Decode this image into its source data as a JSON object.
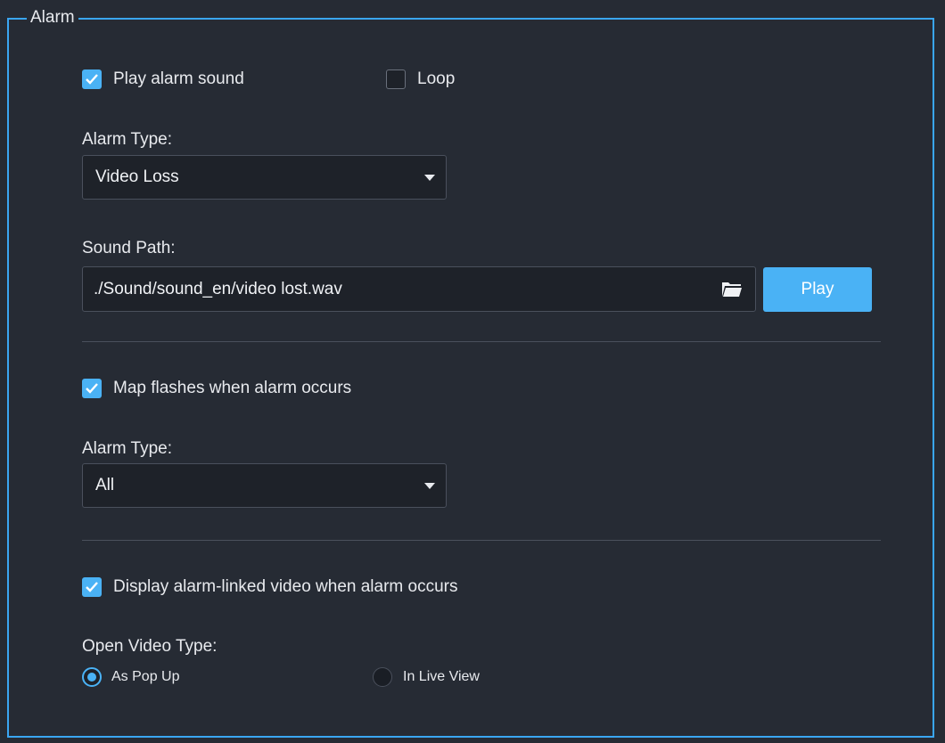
{
  "group": {
    "title": "Alarm"
  },
  "sound": {
    "play_alarm_sound_label": "Play alarm sound",
    "play_alarm_sound_checked": true,
    "loop_label": "Loop",
    "loop_checked": false,
    "alarm_type_label": "Alarm Type:",
    "alarm_type_value": "Video Loss",
    "sound_path_label": "Sound Path:",
    "sound_path_value": "./Sound/sound_en/video lost.wav",
    "play_button_label": "Play"
  },
  "map": {
    "map_flash_label": "Map flashes when alarm occurs",
    "map_flash_checked": true,
    "alarm_type_label": "Alarm Type:",
    "alarm_type_value": "All"
  },
  "video": {
    "display_linked_label": "Display alarm-linked video when alarm occurs",
    "display_linked_checked": true,
    "open_video_type_label": "Open Video Type:",
    "options": [
      {
        "label": "As Pop Up",
        "selected": true
      },
      {
        "label": "In Live View",
        "selected": false
      }
    ]
  },
  "colors": {
    "background": "#262b34",
    "accent": "#4ab2f5",
    "border": "#3aa6f2"
  },
  "icons": {
    "check": "check-icon",
    "folder": "folder-icon",
    "caret": "chevron-down-icon"
  }
}
